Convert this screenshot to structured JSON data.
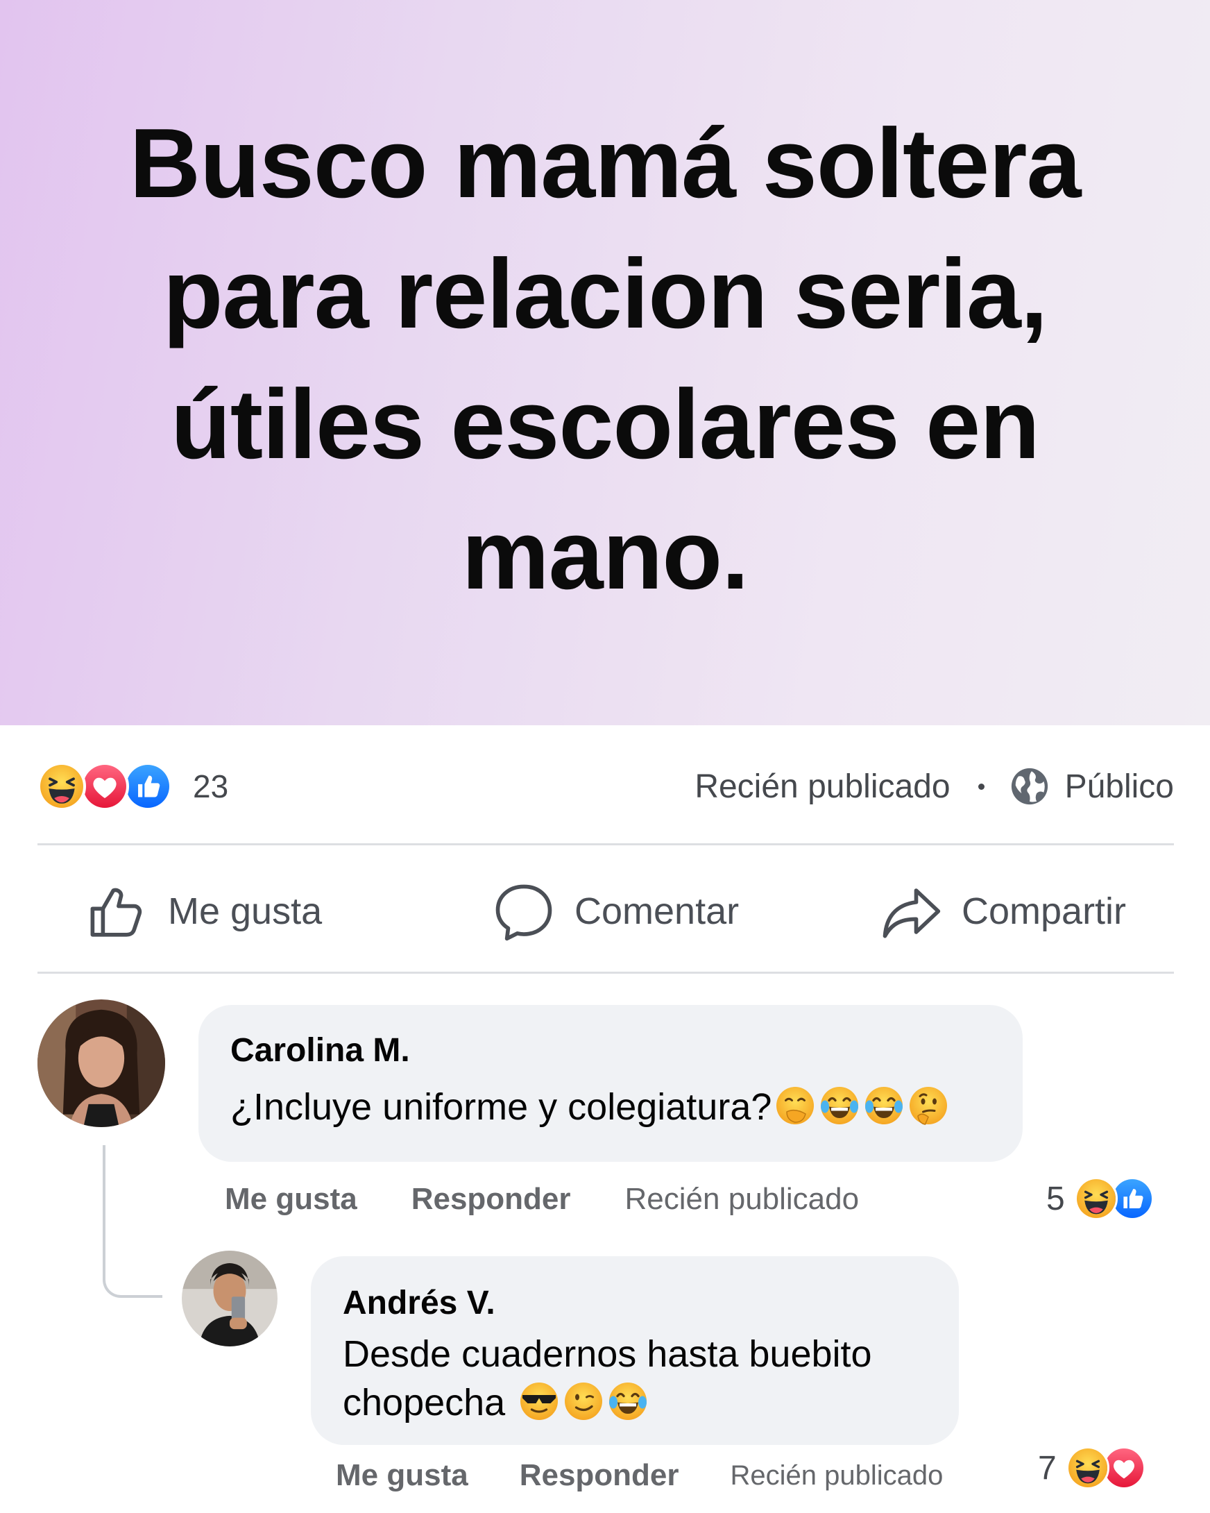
{
  "post": {
    "text": "Busco mamá soltera para relacion seria, útiles escolares en mano.",
    "reaction_count": "23",
    "reaction_icons": [
      "haha-icon",
      "love-icon",
      "like-icon"
    ],
    "timestamp": "Recién publicado",
    "privacy": "Público"
  },
  "actions": {
    "like": "Me gusta",
    "comment": "Comentar",
    "share": "Compartir"
  },
  "comments": [
    {
      "author": "Carolina M.",
      "text": "¿Incluye uniforme y colegiatura?",
      "emojis": [
        "hand-over-mouth-emoji",
        "tears-of-joy-emoji",
        "tears-of-joy-emoji",
        "thinking-emoji"
      ],
      "like_label": "Me gusta",
      "reply_label": "Responder",
      "timestamp": "Recién publicado",
      "reaction_count": "5",
      "reaction_icons": [
        "haha-icon",
        "like-icon"
      ]
    },
    {
      "author": "Andrés V.",
      "text_line1": "Desde cuadernos hasta buebito",
      "text_line2": "chopecha",
      "emojis": [
        "sunglasses-emoji",
        "wink-emoji",
        "tears-of-joy-emoji"
      ],
      "like_label": "Me gusta",
      "reply_label": "Responder",
      "timestamp": "Recién publicado",
      "reaction_count": "7",
      "reaction_icons": [
        "haha-icon",
        "love-icon"
      ]
    }
  ],
  "colors": {
    "like_blue": "#1877f2",
    "love_red": "#f33e58",
    "haha_yellow": "#f7b125",
    "bubble_bg": "#f0f2f5",
    "secondary_text": "#65676b"
  }
}
